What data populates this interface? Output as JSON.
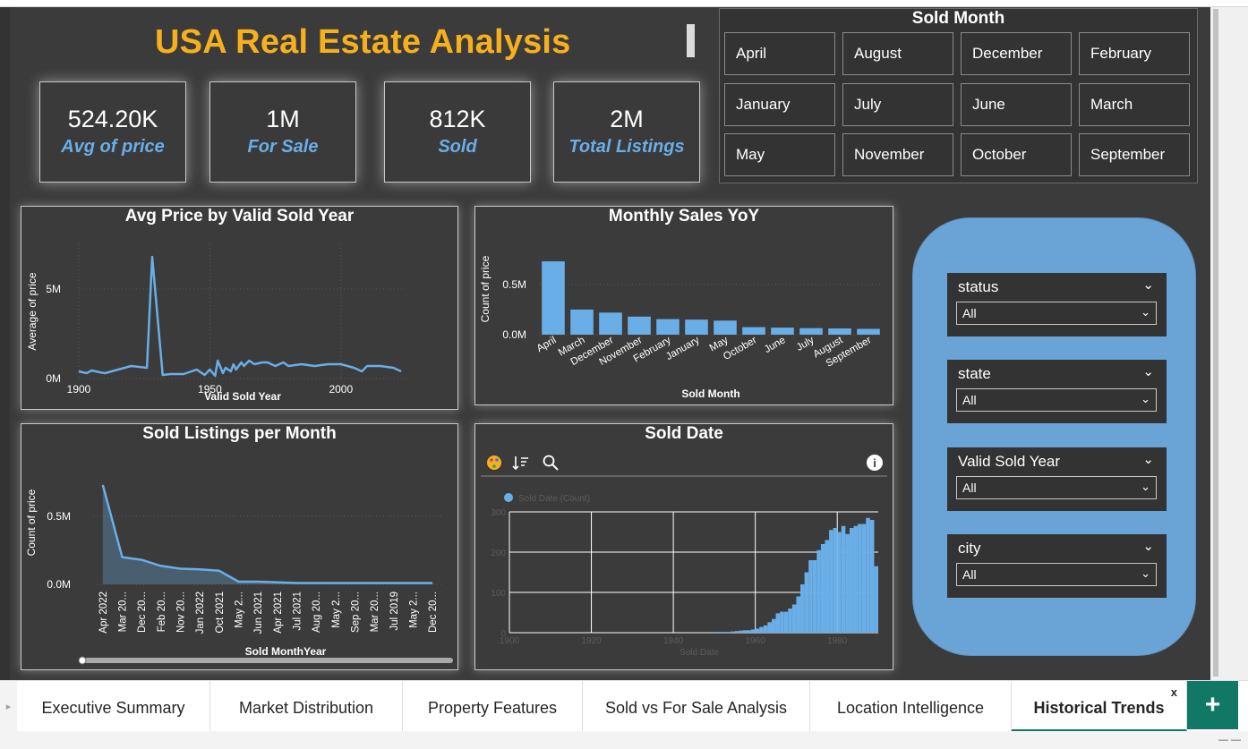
{
  "title": "USA Real Estate Analysis",
  "kpis": [
    {
      "value": "524.20K",
      "label": "Avg of price"
    },
    {
      "value": "1M",
      "label": "For Sale"
    },
    {
      "value": "812K",
      "label": "Sold"
    },
    {
      "value": "2M",
      "label": "Total Listings"
    }
  ],
  "sold_month_slicer": {
    "title": "Sold Month",
    "options": [
      "April",
      "August",
      "December",
      "February",
      "January",
      "July",
      "June",
      "March",
      "May",
      "November",
      "October",
      "September"
    ]
  },
  "filters": [
    {
      "label": "status",
      "value": "All"
    },
    {
      "label": "state",
      "value": "All"
    },
    {
      "label": "Valid Sold Year",
      "value": "All"
    },
    {
      "label": "city",
      "value": "All"
    }
  ],
  "tabs": [
    {
      "label": "Executive Summary",
      "active": false
    },
    {
      "label": "Market Distribution",
      "active": false
    },
    {
      "label": "Property Features",
      "active": false
    },
    {
      "label": "Sold vs For Sale Analysis",
      "active": false
    },
    {
      "label": "Location Intelligence",
      "active": false
    },
    {
      "label": "Historical Trends",
      "active": true
    }
  ],
  "add_tab_label": "+",
  "close_tab_label": "x",
  "icons": [
    "palette-icon",
    "sort-icon",
    "zoom-icon",
    "info-icon",
    "chevron-down-icon",
    "plus-icon",
    "close-icon"
  ],
  "colors": {
    "accent": "#f6b01e",
    "series": "#6aaee8",
    "filter_pane": "#6aa3d5",
    "tab_accent": "#117865",
    "background": "#3b3b3b"
  },
  "chart_data": [
    {
      "id": "avg-price-by-year",
      "type": "line",
      "title": "Avg Price by Valid Sold Year",
      "xlabel": "Valid Sold Year",
      "ylabel": "Average of price",
      "xlim": [
        1900,
        2025
      ],
      "ylim": [
        0,
        7500000
      ],
      "x_ticks": [
        1900,
        1950,
        2000
      ],
      "x_tick_labels": [
        "1900",
        "1950",
        "2000"
      ],
      "y_ticks": [
        0,
        5000000
      ],
      "y_tick_labels": [
        "0M",
        "5M"
      ],
      "grid": true,
      "x": [
        1900,
        1903,
        1905,
        1908,
        1910,
        1920,
        1926,
        1928,
        1932,
        1935,
        1940,
        1945,
        1948,
        1950,
        1952,
        1953,
        1955,
        1956,
        1958,
        1959,
        1960,
        1962,
        1963,
        1965,
        1967,
        1970,
        1972,
        1975,
        1978,
        1980,
        1985,
        1990,
        1995,
        2000,
        2005,
        2008,
        2010,
        2015,
        2020,
        2023
      ],
      "y": [
        400000,
        300000,
        450000,
        350000,
        300000,
        700000,
        600000,
        6800000,
        200000,
        250000,
        250000,
        500000,
        200000,
        500000,
        150000,
        1000000,
        300000,
        600000,
        400000,
        800000,
        500000,
        900000,
        700000,
        1000000,
        800000,
        900000,
        900000,
        700000,
        900000,
        700000,
        800000,
        700000,
        800000,
        800000,
        600000,
        400000,
        700000,
        700000,
        600000,
        400000
      ]
    },
    {
      "id": "monthly-sales-yoy",
      "type": "bar",
      "title": "Monthly Sales YoY",
      "xlabel": "Sold Month",
      "ylabel": "Count of price",
      "ylim": [
        0,
        0.9
      ],
      "y_ticks": [
        0,
        0.5
      ],
      "y_tick_labels": [
        "0.0M",
        "0.5M"
      ],
      "grid": true,
      "categories": [
        "April",
        "March",
        "December",
        "November",
        "February",
        "January",
        "May",
        "October",
        "June",
        "July",
        "August",
        "September"
      ],
      "values": [
        0.73,
        0.25,
        0.22,
        0.18,
        0.155,
        0.15,
        0.14,
        0.075,
        0.07,
        0.065,
        0.062,
        0.058
      ]
    },
    {
      "id": "sold-listings-per-month",
      "type": "area",
      "title": "Sold Listings per Month",
      "xlabel": "Sold MonthYear",
      "ylabel": "Count of price",
      "ylim": [
        0,
        0.9
      ],
      "y_ticks": [
        0,
        0.5
      ],
      "y_tick_labels": [
        "0.0M",
        "0.5M"
      ],
      "grid": true,
      "categories": [
        "Apr 2022",
        "Mar 20...",
        "Dec 20...",
        "Feb 20...",
        "Nov 20...",
        "Jan 2022",
        "Oct 2021",
        "May 2...",
        "Jun 2021",
        "Apr 2021",
        "Jul 2021",
        "Aug 20...",
        "May 2...",
        "Sep 20...",
        "Mar 20...",
        "Jul 2019",
        "May 2...",
        "Dec 20..."
      ],
      "values": [
        0.73,
        0.2,
        0.18,
        0.135,
        0.115,
        0.11,
        0.1,
        0.02,
        0.02,
        0.015,
        0.01,
        0.01,
        0.01,
        0.01,
        0.01,
        0.01,
        0.01,
        0.01
      ]
    },
    {
      "id": "sold-date-histogram",
      "type": "bar",
      "title": "Sold Date",
      "legend": "Sold Date (Count)",
      "legend_position": "top-left",
      "xlabel": "Sold Date",
      "xlim": [
        1900,
        1990
      ],
      "ylim": [
        0,
        300
      ],
      "x_ticks": [
        1900,
        1920,
        1940,
        1960,
        1980
      ],
      "x_tick_labels": [
        "1900",
        "1920",
        "1940",
        "1960",
        "1980"
      ],
      "y_ticks": [
        0,
        100,
        200,
        300
      ],
      "y_tick_labels": [
        "0",
        "100",
        "200",
        "300"
      ],
      "grid": true,
      "bin_start": [
        1950,
        1952,
        1954,
        1955,
        1956,
        1957,
        1958,
        1959,
        1960,
        1961,
        1962,
        1963,
        1964,
        1965,
        1966,
        1967,
        1968,
        1969,
        1970,
        1971,
        1972,
        1973,
        1974,
        1975,
        1976,
        1977,
        1978,
        1979,
        1980,
        1981,
        1982,
        1983,
        1984,
        1985,
        1986,
        1987,
        1988,
        1989
      ],
      "counts": [
        2,
        2,
        3,
        4,
        5,
        6,
        6,
        8,
        10,
        14,
        18,
        26,
        34,
        48,
        52,
        52,
        60,
        70,
        90,
        120,
        150,
        180,
        180,
        205,
        220,
        230,
        255,
        260,
        250,
        265,
        245,
        260,
        265,
        270,
        270,
        285,
        280,
        165
      ]
    }
  ]
}
